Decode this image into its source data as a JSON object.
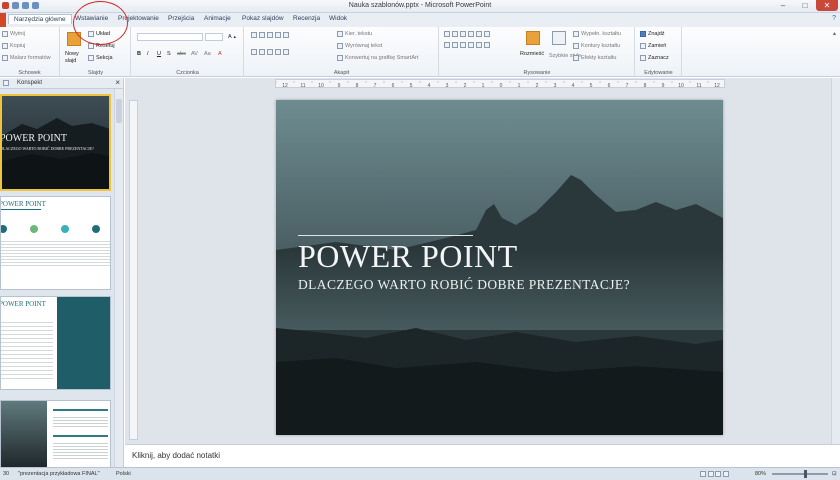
{
  "window": {
    "title": "Nauka szablonów.pptx - Microsoft PowerPoint",
    "controls": [
      "–",
      "□",
      "✕"
    ]
  },
  "tabs": [
    {
      "label": "Narzędzia główne",
      "active": true
    },
    {
      "label": "Wstawianie"
    },
    {
      "label": "Projektowanie"
    },
    {
      "label": "Przejścia"
    },
    {
      "label": "Animacje"
    },
    {
      "label": "Pokaz slajdów"
    },
    {
      "label": "Recenzja"
    },
    {
      "label": "Widok"
    }
  ],
  "ribbon": {
    "clipboard": {
      "cut": "Wytnij",
      "copy": "Kopiuj",
      "painter": "Malarz formatów",
      "label": "Schowek"
    },
    "slides": {
      "new_slide": "Nowy",
      "new_slide2": "slajd",
      "layout": "Układ",
      "reset": "Resetuj",
      "section": "Sekcja",
      "label": "Slajdy"
    },
    "font": {
      "label": "Czcionka",
      "buttons": [
        "B",
        "I",
        "U",
        "S",
        "abc",
        "AV",
        "Aa",
        "A"
      ]
    },
    "paragraph": {
      "text_direction": "Kier. tekstu",
      "align_text": "Wyrównaj tekst",
      "convert_smartart": "Konwertuj na grafikę SmartArt",
      "label": "Akapit"
    },
    "drawing": {
      "arrange": "Rozmieść",
      "quick_styles": "Szybkie style",
      "fill": "Wypełn. kształtu",
      "outline": "Kontury kształtu",
      "effects": "Efekty kształtu",
      "label": "Rysowanie"
    },
    "editing": {
      "find": "Znajdź",
      "replace": "Zamień",
      "select": "Zaznacz",
      "label": "Edytowanie"
    }
  },
  "panel": {
    "tab_label": "Konspekt",
    "thumb1": {
      "title": "POWER POINT",
      "subtitle": "DLACZEGO WARTO ROBIĆ DOBRE PREZENTACJE?"
    },
    "thumb2": {
      "title": "POWER POINT"
    },
    "thumb3": {
      "title": "POWER POINT"
    }
  },
  "ruler": {
    "marks": [
      "12",
      "11",
      "10",
      "9",
      "8",
      "7",
      "6",
      "5",
      "4",
      "3",
      "2",
      "1",
      "0",
      "1",
      "2",
      "3",
      "4",
      "5",
      "6",
      "7",
      "8",
      "9",
      "10",
      "11",
      "12"
    ]
  },
  "slide": {
    "title": "POWER POINT",
    "subtitle": "DLACZEGO WARTO ROBIĆ DOBRE PREZENTACJE?"
  },
  "notes": {
    "placeholder": "Kliknij, aby dodać notatki"
  },
  "status": {
    "slide": "30",
    "theme": "\"prezentacja przykładowa FINAL\"",
    "language": "Polski",
    "zoom": "80%"
  },
  "colors": {
    "annotation": "#d32a2a",
    "file_tab": "#d24726",
    "selected_thumb": "#f0c33c"
  }
}
